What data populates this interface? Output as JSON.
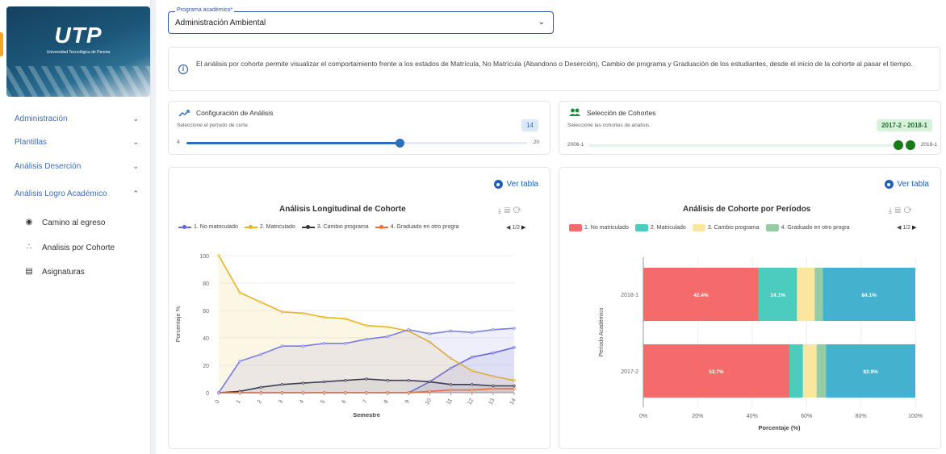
{
  "sidebar": {
    "logo_text": "UTP",
    "logo_subtitle": "Universidad Tecnológica de Pereira",
    "items": [
      {
        "label": "Administración"
      },
      {
        "label": "Plantillas"
      },
      {
        "label": "Análisis Deserción"
      },
      {
        "label": "Análisis Logro Académico"
      }
    ],
    "sub_items": [
      {
        "label": "Camino al egreso"
      },
      {
        "label": "Analisis por Cohorte"
      },
      {
        "label": "Asignaturas"
      }
    ]
  },
  "program": {
    "label": "Programa académico*",
    "value": "Administración Ambiental"
  },
  "info": {
    "text": "El análisis por cohorte permite visualizar el comportamiento frente a los estados de Matrícula, No Matrícula (Abandono o Deserción), Cambio de programa y Graduación de los estudiantes, desde el inicio de la cohorte al pasar el tiempo."
  },
  "config": {
    "title": "Configuración de Análisis",
    "subtitle": "Seleccione el período de corte",
    "value": "14",
    "min": "4",
    "max": "20",
    "fraction": 0.625
  },
  "cohorts": {
    "title": "Selección de Cohortes",
    "subtitle": "Seleccione las cohortes de análisis",
    "badge": "2017-2 - 2018-1",
    "min": "2006-1",
    "max": "2018-1"
  },
  "left_panel": {
    "ver_tabla": "Ver tabla",
    "title": "Análisis Longitudinal de Cohorte",
    "pager": "1/2",
    "legend": [
      "1. No matriculado",
      "2. Matriculado",
      "3. Cambio programa",
      "4. Graduado en otro progra"
    ]
  },
  "right_panel": {
    "ver_tabla": "Ver tabla",
    "title": "Análisis de Cohorte por Períodos",
    "pager": "1/2",
    "legend": [
      "1. No matriculado",
      "2. Matriculado",
      "3. Cambio programa",
      "4. Graduado en otro progra"
    ]
  },
  "colors": {
    "no_matriculado": "#6366e0",
    "matriculado": "#e6b422",
    "cambio": "#333344",
    "graduado_otro": "#f07030",
    "bar_no_mat": "#f56a6a",
    "bar_mat": "#4ccbbf",
    "bar_cambio": "#fbe6a0",
    "bar_grad_otro": "#96cca4",
    "bar_grad": "#44b2cf"
  },
  "chart_data": [
    {
      "type": "line",
      "title": "Análisis Longitudinal de Cohorte",
      "xlabel": "Semestre",
      "ylabel": "Porcentaje %",
      "x": [
        0,
        1,
        2,
        3,
        4,
        5,
        6,
        7,
        8,
        9,
        10,
        11,
        12,
        13,
        14
      ],
      "ylim": [
        0,
        100
      ],
      "yticks": [
        0,
        20,
        40,
        60,
        80,
        100
      ],
      "series": [
        {
          "name": "1. No matriculado",
          "values": [
            0,
            0,
            0,
            0,
            0,
            0,
            0,
            0,
            0,
            0,
            8,
            18,
            26,
            29,
            33
          ]
        },
        {
          "name": "2. Matriculado",
          "values": [
            100,
            73,
            66,
            59,
            58,
            55,
            54,
            49,
            48,
            45,
            37,
            25,
            16,
            12,
            9
          ]
        },
        {
          "name": "3. Cambio programa",
          "values": [
            0,
            1,
            4,
            6,
            7,
            8,
            9,
            10,
            9,
            9,
            8,
            6,
            6,
            5,
            5
          ]
        },
        {
          "name": "4. Graduado en otro progra",
          "values": [
            0,
            0,
            0,
            0,
            0,
            0,
            0,
            0,
            0,
            0,
            1,
            2,
            2,
            3,
            3
          ]
        },
        {
          "values": [
            0,
            23,
            28,
            34,
            34,
            36,
            36,
            39,
            41,
            46,
            43,
            45,
            44,
            46,
            47
          ]
        }
      ]
    },
    {
      "type": "bar",
      "orientation": "horizontal",
      "stacked": true,
      "title": "Análisis de Cohorte por Períodos",
      "xlabel": "Porcentaje (%)",
      "ylabel": "Período Académico",
      "categories": [
        "2018-1",
        "2017-2"
      ],
      "xticks": [
        "0%",
        "20%",
        "40%",
        "60%",
        "80%",
        "100%"
      ],
      "series": [
        {
          "name": "1. No matriculado",
          "values": [
            42.4,
            53.7
          ],
          "labels": [
            "42.4%",
            "53.7%"
          ]
        },
        {
          "name": "2. Matriculado",
          "values": [
            14.1,
            5.0
          ],
          "labels": [
            "14.1%",
            ""
          ]
        },
        {
          "name": "3. Cambio programa",
          "values": [
            6.5,
            5.0
          ],
          "labels": [
            "",
            ""
          ]
        },
        {
          "name": "4. Graduado en otro progra",
          "values": [
            3.0,
            3.5
          ],
          "labels": [
            "",
            ""
          ]
        },
        {
          "values": [
            34.0,
            32.8
          ],
          "labels": [
            "84.1%",
            "82.9%"
          ]
        }
      ]
    }
  ]
}
